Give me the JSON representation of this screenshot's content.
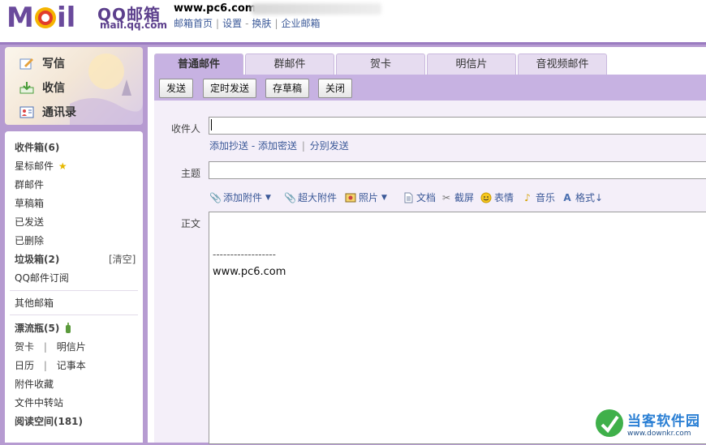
{
  "header": {
    "logo_text": "MOil",
    "brand_cn": "QQ邮箱",
    "brand_en": "mail.qq.com",
    "account": "www.pc6.com",
    "links": [
      "邮箱首页",
      "设置",
      "换肤",
      "企业邮箱"
    ],
    "link_seps": [
      "|",
      "-",
      "|"
    ]
  },
  "sidebar": {
    "top": [
      {
        "label": "写信",
        "icon": "compose-icon"
      },
      {
        "label": "收信",
        "icon": "inbox-download-icon"
      },
      {
        "label": "通讯录",
        "icon": "contacts-icon"
      }
    ],
    "folders": {
      "inbox": "收件箱(6)",
      "starred": "星标邮件",
      "group": "群邮件",
      "drafts": "草稿箱",
      "sent": "已发送",
      "deleted": "已删除",
      "junk": "垃圾箱(2)",
      "junk_clear": "[清空]",
      "subscriptions": "QQ邮件订阅",
      "other": "其他邮箱",
      "bottle": "漂流瓶(5)",
      "card": "贺卡",
      "sep1": "|",
      "postcard": "明信片",
      "calendar": "日历",
      "sep2": "|",
      "notebook": "记事本",
      "attachments": "附件收藏",
      "transfer": "文件中转站",
      "reading": "阅读空间(181)"
    }
  },
  "tabs": [
    "普通邮件",
    "群邮件",
    "贺卡",
    "明信片",
    "音视频邮件"
  ],
  "toolbar": {
    "send": "发送",
    "scheduled": "定时发送",
    "save_draft": "存草稿",
    "close": "关闭"
  },
  "compose": {
    "to_label": "收件人",
    "to_value": "",
    "add_cc": "添加抄送",
    "dash": "-",
    "add_bcc": "添加密送",
    "bar": "|",
    "separate_send": "分别发送",
    "subject_label": "主题",
    "subject_value": "",
    "attach": {
      "add_attachment": "添加附件",
      "big_attachment": "超大附件",
      "photo": "照片",
      "document": "文档",
      "screenshot": "截屏",
      "emoji": "表情",
      "music": "音乐",
      "format": "格式↓"
    },
    "body_label": "正文",
    "signature_line": "------------------",
    "signature_text": "www.pc6.com"
  },
  "watermark": {
    "name": "当客软件园",
    "url": "www.downkr.com"
  },
  "colors": {
    "frame": "#b69bd1",
    "tab_active": "#c7b2e2",
    "link": "#3b5998",
    "brand": "#5c3f8c"
  }
}
